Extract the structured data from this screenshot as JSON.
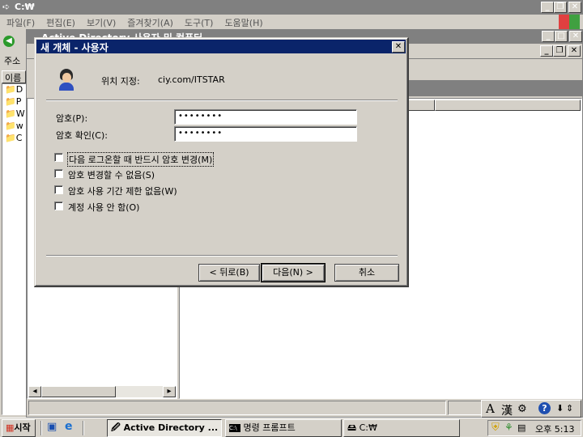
{
  "explorer": {
    "title": "C:₩",
    "menu": [
      "파일(F)",
      "편집(E)",
      "보기(V)",
      "즐겨찾기(A)",
      "도구(T)",
      "도움말(H)"
    ],
    "address_label": "주소",
    "list_header": "이름",
    "tree_items": [
      "D",
      "P",
      "W",
      "w",
      "C"
    ]
  },
  "ad_window": {
    "title": "Active Directory 사용자 및 컴퓨터"
  },
  "dialog": {
    "title": "새 개체 - 사용자",
    "location_label": "위치 지정:",
    "location_value": "ciy.com/ITSTAR",
    "password_label": "암호(P):",
    "password_value": "••••••••",
    "confirm_label": "암호 확인(C):",
    "confirm_value": "••••••••",
    "options": [
      {
        "label": "다음 로그온할 때 반드시 암호 변경(M)",
        "checked": false
      },
      {
        "label": "암호 변경할 수 없음(S)",
        "checked": false
      },
      {
        "label": "암호 사용 기간 제한 없음(W)",
        "checked": false
      },
      {
        "label": "계정 사용 안 함(O)",
        "checked": false
      }
    ],
    "back_label": "< 뒤로(B)",
    "next_label": "다음(N) >",
    "cancel_label": "취소"
  },
  "taskbar": {
    "start_label": "시작",
    "tasks": [
      "Active Directory ...",
      "명령 프롬프트",
      "C:₩"
    ],
    "clock": "오후 5:13"
  },
  "ime": {
    "mode": "A",
    "hanja": "漢"
  }
}
